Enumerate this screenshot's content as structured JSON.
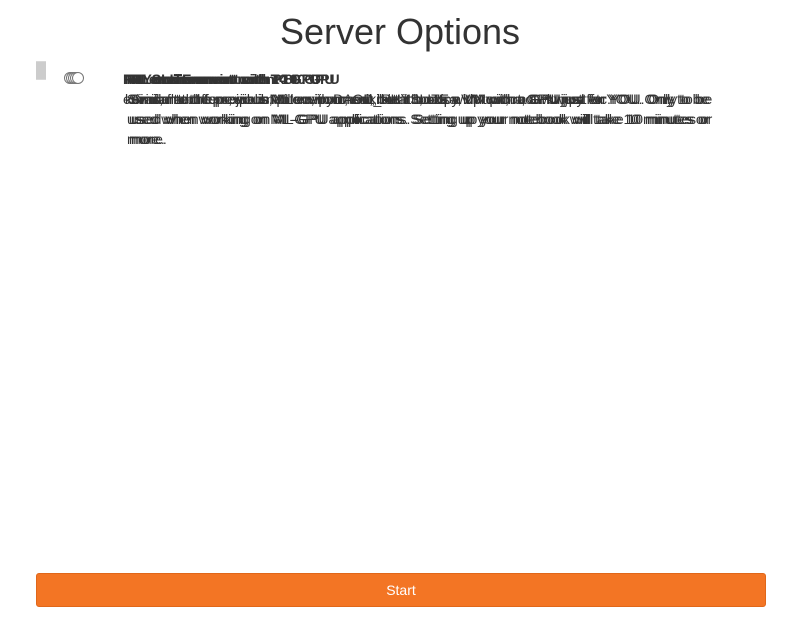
{
  "page": {
    "title": "Server Options"
  },
  "options": [
    {
      "name": "PHYSLITE environment",
      "description": "environment for experiments with DAOD_PHYSLITE with uproot, awkward etc.",
      "selected": false
    },
    {
      "name": "ML environment",
      "description": "keras, flatbuffers, joblib, pillow, pytz, scikit-learn, scipy, uproot, root-numpy",
      "selected": false
    },
    {
      "name": "ML environment with T4 GPU",
      "description": "Similar to the previous ML environment, but it boots a VM with a GPU just for YOU. Only to be used when working on ML-GPU applications. Setting up your notebook will take 10 minutes or more.",
      "selected": false
    },
    {
      "name": "ML environment with P100 GPU",
      "description": "Similar to the previous ML environment, but it boots a VM with a GPU just for YOU. Only to be used when working on ML-GPU applications. Setting up your notebook will take 10 minutes or more.",
      "selected": false
    },
    {
      "name": "ML environment with K80 GPU",
      "description": "Similar to the previous ML environment, but it boots a VM with a GPU just for YOU. Only to be used when working on ML-GPU applications. Setting up your notebook will take 10 minutes or more.",
      "selected": false
    }
  ],
  "actions": {
    "start_label": "Start"
  },
  "colors": {
    "start_button": "#f37524",
    "option_border": "#cccccc",
    "text": "#333333"
  }
}
